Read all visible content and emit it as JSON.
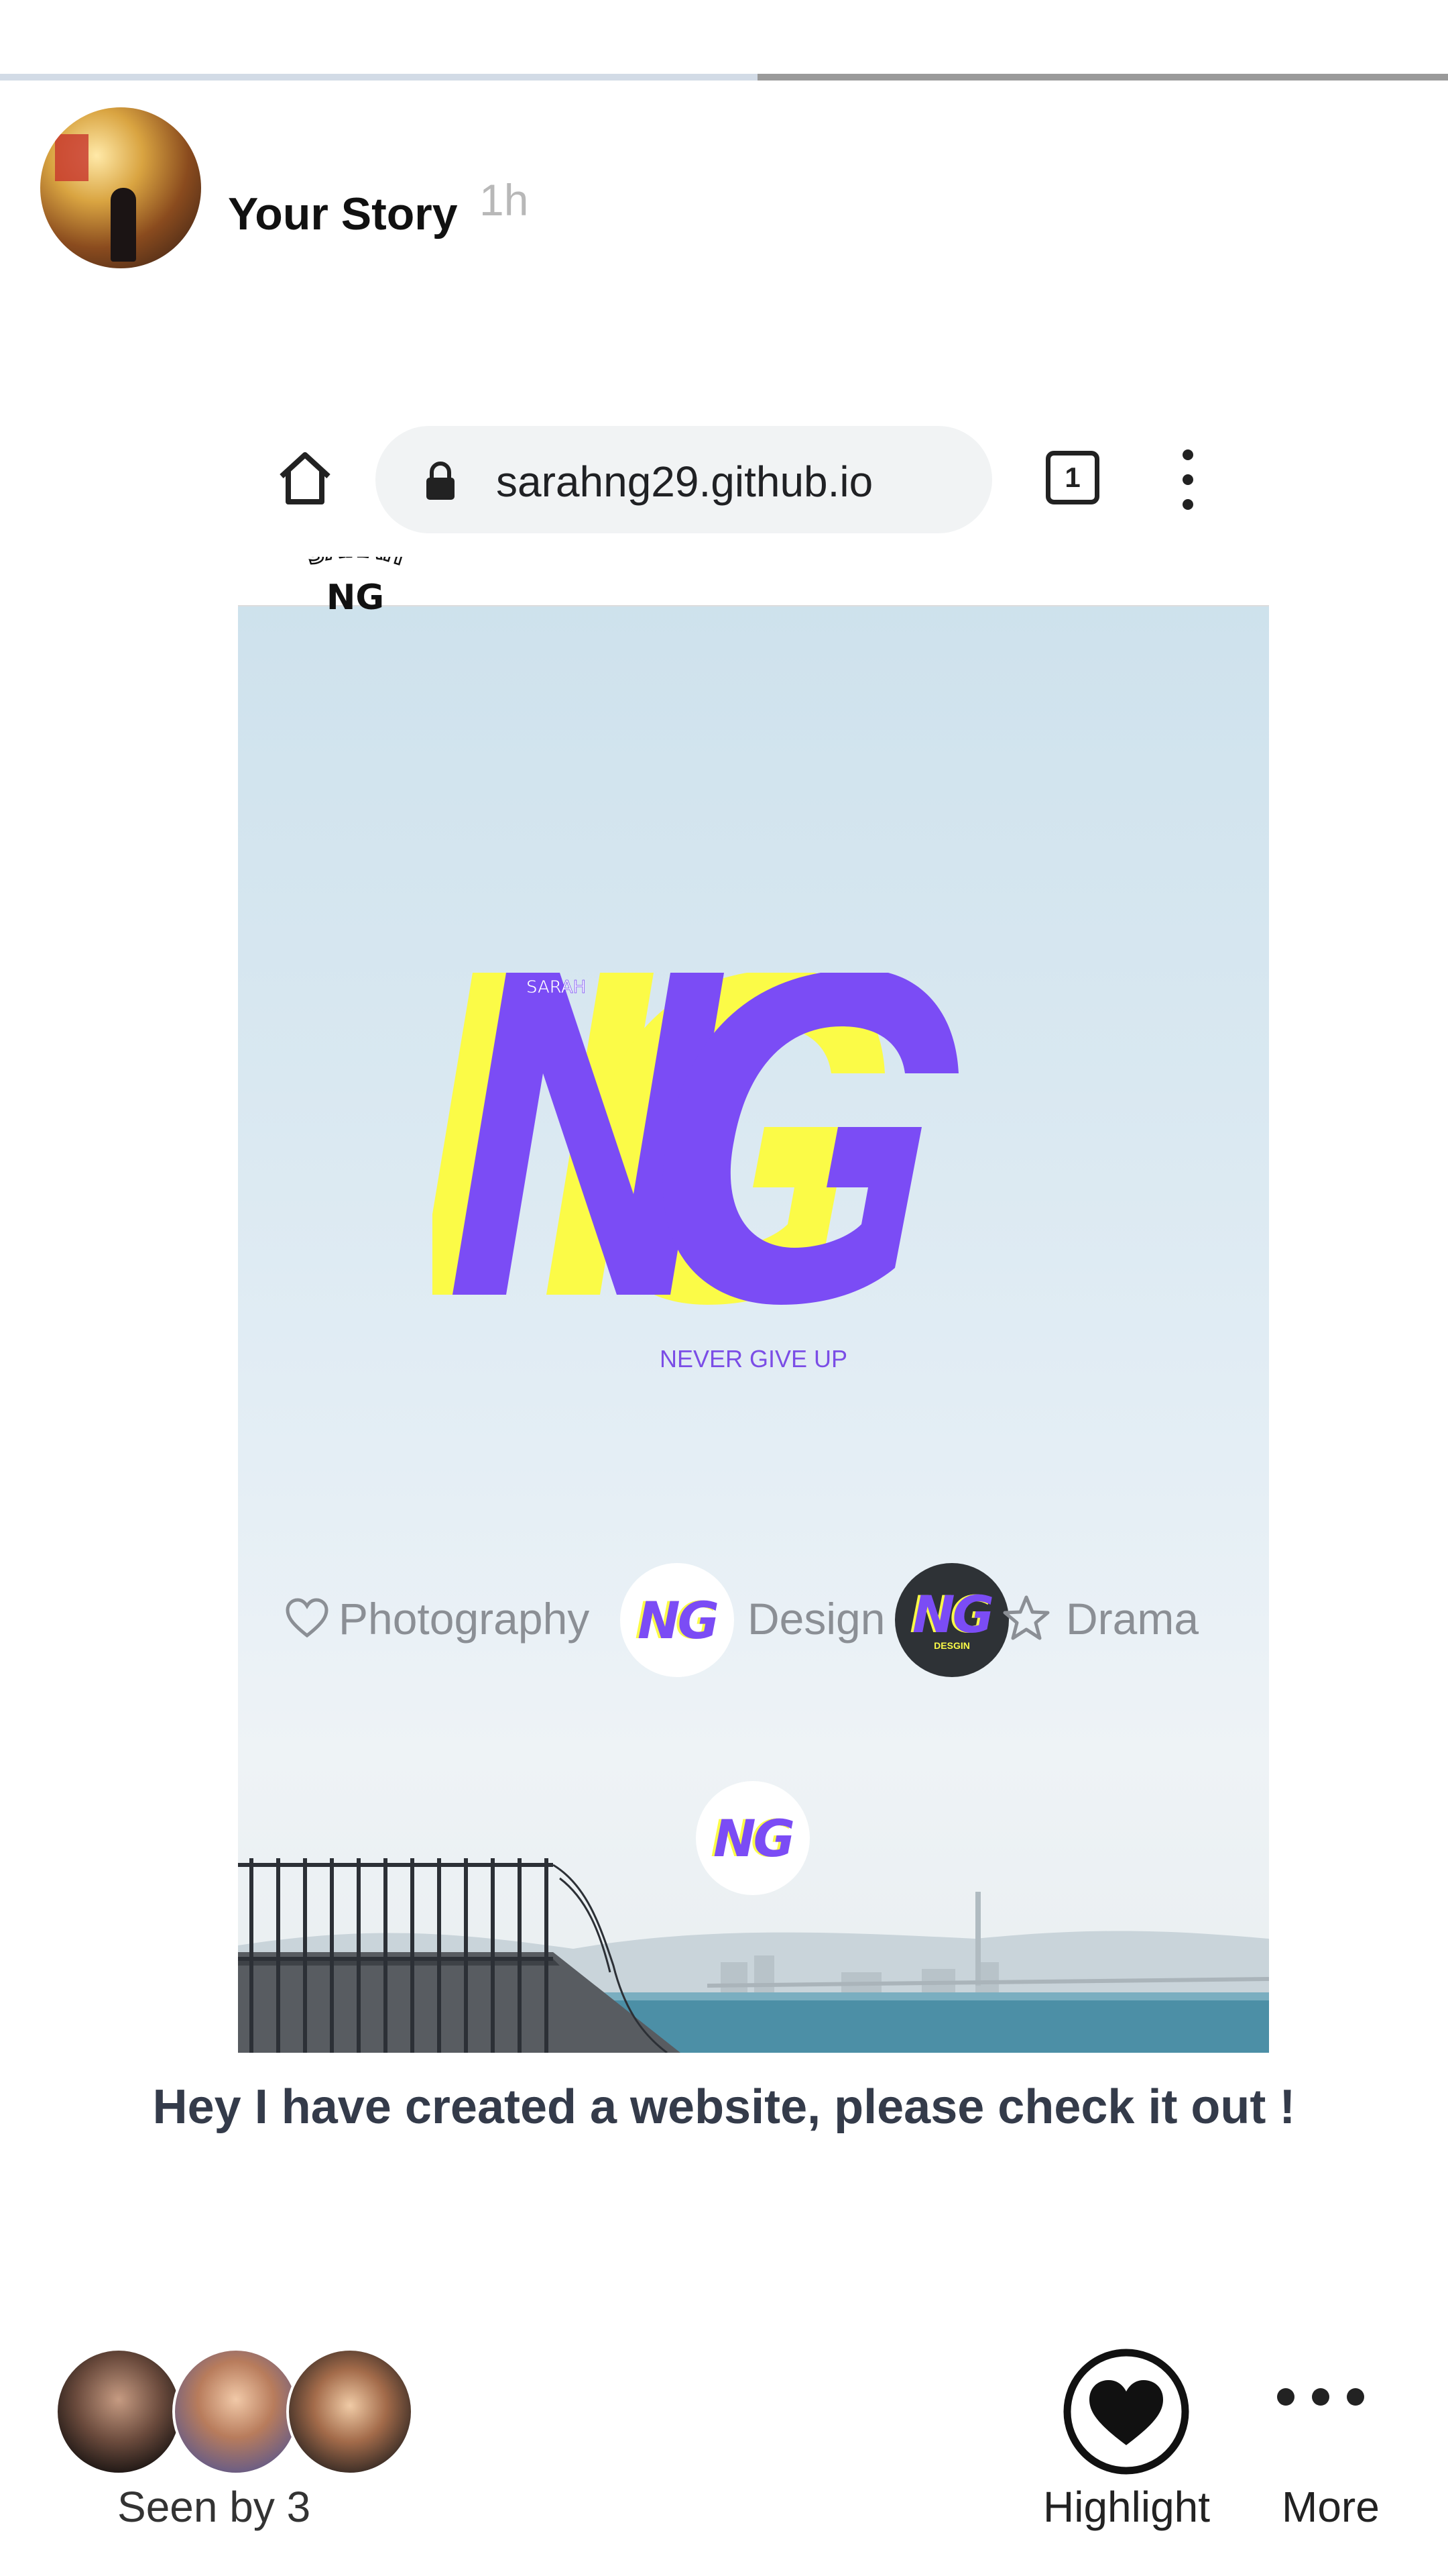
{
  "story": {
    "progress_fraction": 0.523,
    "title": "Your Story",
    "time": "1h"
  },
  "browser": {
    "url": "sarahng29.github.io",
    "tab_count": "1"
  },
  "site": {
    "topbar_logo_text": "SARAH",
    "topbar_logo_mark": "NG",
    "logo_small": "SARAH",
    "tagline": "NEVER GIVE UP",
    "nav": {
      "photography": "Photography",
      "design": "Design",
      "drama": "Drama"
    },
    "badge_mark": "NG",
    "badge_dark_sub": "DESGIN"
  },
  "caption": "Hey I have created a website, please check it out !",
  "footer": {
    "seen_by": "Seen by 3",
    "highlight_label": "Highlight",
    "more_label": "More"
  },
  "colors": {
    "purple": "#7b4cf5",
    "yellow": "#fbfb47",
    "progress_done": "#d2dbe6",
    "progress_remaining": "#9a9a9a",
    "caption": "#343b4a"
  }
}
